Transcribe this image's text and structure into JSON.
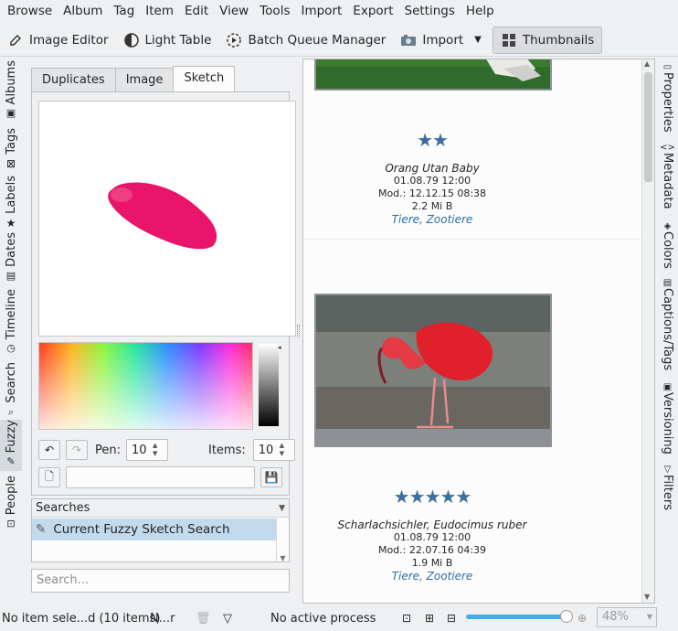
{
  "menu": {
    "browse": "Browse",
    "album": "Album",
    "tag": "Tag",
    "item": "Item",
    "edit": "Edit",
    "view": "View",
    "tools": "Tools",
    "import": "Import",
    "export": "Export",
    "settings": "Settings",
    "help": "Help"
  },
  "toolbar": {
    "image_editor": "Image Editor",
    "light_table": "Light Table",
    "batch_queue": "Batch Queue Manager",
    "import": "Import",
    "thumbnails": "Thumbnails"
  },
  "left_tabs": [
    "Albums",
    "Tags",
    "Labels",
    "Dates",
    "Timeline",
    "Search",
    "Fuzzy",
    "People"
  ],
  "right_tabs": [
    "Properties",
    "Metadata",
    "Colors",
    "Captions/Tags",
    "Versioning",
    "Filters"
  ],
  "panel_tabs": [
    "Duplicates",
    "Image",
    "Sketch"
  ],
  "sketch": {
    "pen_label": "Pen:",
    "pen_value": "10",
    "items_label": "Items:",
    "items_value": "10",
    "sketch_color": "#e8156a"
  },
  "searches": {
    "header": "Searches",
    "current": "Current Fuzzy Sketch Search"
  },
  "search_placeholder": "Search...",
  "thumbs": [
    {
      "rating": 2,
      "stars": "★★",
      "title": "Orang Utan Baby",
      "date": "01.08.79 12:00",
      "mod": "Mod.: 12.12.15 08:38",
      "size": "2.2 Mi B",
      "tags": "Tiere, Zootiere"
    },
    {
      "rating": 5,
      "stars": "★★★★★",
      "title": "Scharlachsichler, Eudocimus ruber",
      "date": "01.08.79 12:00",
      "mod": "Mod.: 22.07.16 04:39",
      "size": "1.9 Mi B",
      "tags": "Tiere, Zootiere"
    }
  ],
  "status": {
    "selection": "No item sele...d (10 items)",
    "filter": "N...r",
    "process": "No active process",
    "zoom": "48%"
  },
  "colors": {
    "accent": "#3daee9",
    "star": "#3c6d9c",
    "tag_link": "#2f6ea7",
    "selection": "#c3d9ec"
  }
}
